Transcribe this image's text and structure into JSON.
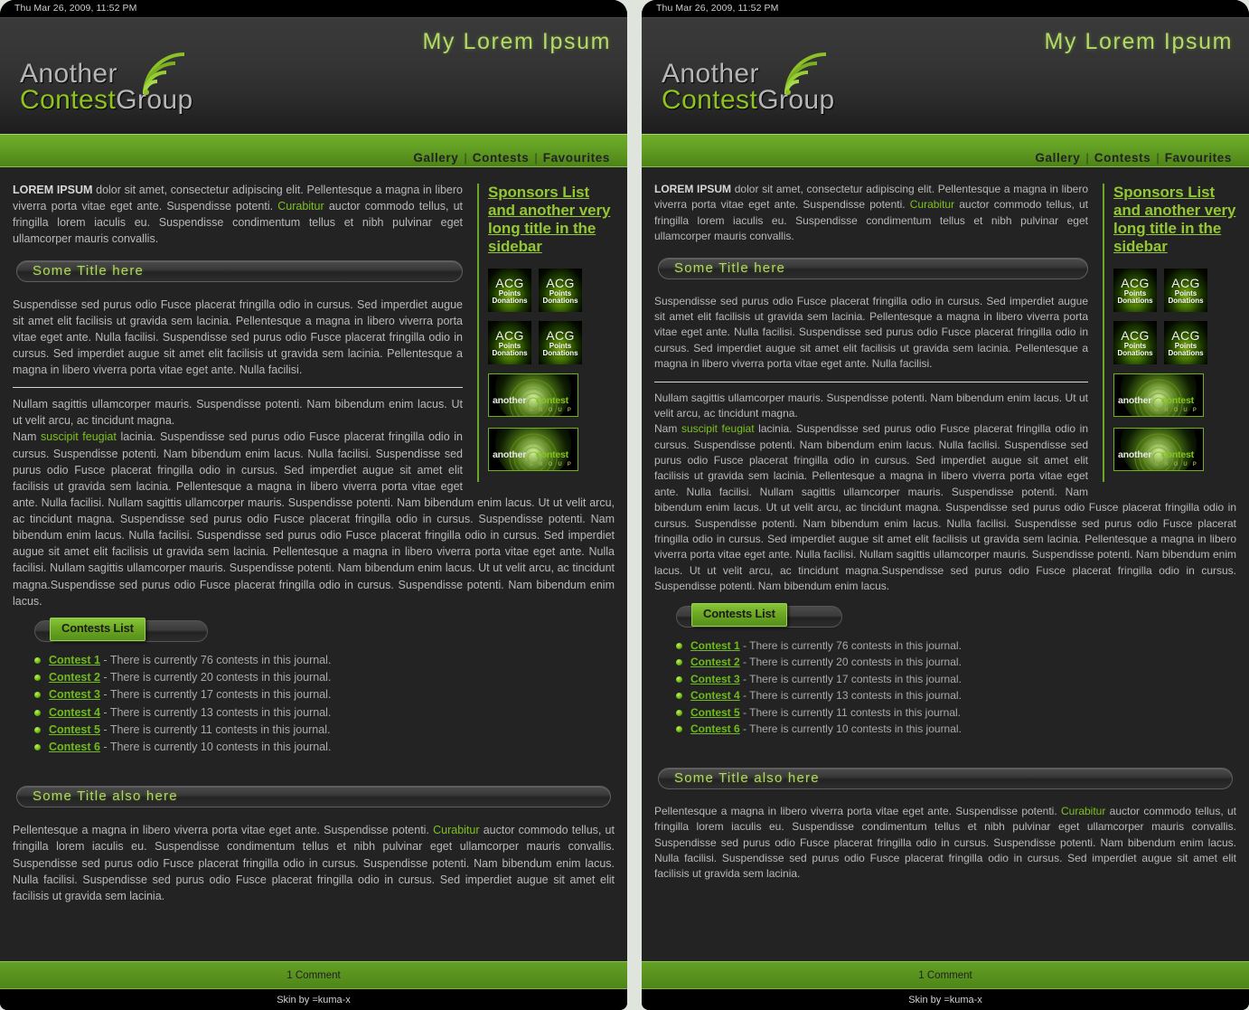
{
  "page": {
    "background_color": "#dfe5dc",
    "accent_green": "#63a024",
    "text_green": "#7cc11e"
  },
  "datebar": {
    "text": "Thu Mar 26, 2009, 11:52 PM"
  },
  "header": {
    "site_title": "My Lorem Ipsum",
    "logo": {
      "word1": "Another",
      "word2": "Contest",
      "word3": "Group",
      "icon": "wifi-arc-icon"
    }
  },
  "nav": {
    "items": [
      {
        "label": "Gallery"
      },
      {
        "label": "Contests"
      },
      {
        "label": "Favourites"
      }
    ],
    "separator": "|"
  },
  "main": {
    "lead_strong": "LOREM IPSUM",
    "lead_text_1": " dolor sit amet, consectetur adipiscing elit. Pellentesque a magna in libero viverra porta vitae eget ante. Suspendisse potenti. ",
    "lead_link": "Curabitur",
    "lead_text_2": " auctor commodo tellus, ut fringilla lorem iaculis eu. Suspendisse condimentum tellus et nibh pulvinar eget ullamcorper mauris convallis.",
    "section_title_1": "Some Title here",
    "para_1": "Suspendisse sed purus odio Fusce placerat fringilla odio in cursus. Sed imperdiet augue sit amet elit facilisis ut gravida sem lacinia. Pellentesque a magna in libero viverra porta vitae eget ante. Nulla facilisi. Suspendisse sed purus odio Fusce placerat fringilla odio in cursus. Sed imperdiet augue sit amet elit facilisis ut gravida sem lacinia. Pellentesque a magna in libero viverra porta vitae eget ante. Nulla facilisi.",
    "para_2": "Nullam sagittis ullamcorper mauris. Suspendisse potenti. Nam bibendum enim lacus. Ut ut velit arcu, ac tincidunt magna.",
    "para_3_pre": "Nam ",
    "para_3_link": "suscipit feugiat",
    "para_3_post": " lacinia. Suspendisse sed purus odio Fusce placerat fringilla odio in cursus. Suspendisse potenti. Nam bibendum enim lacus. Nulla facilisi. Suspendisse sed purus odio Fusce placerat fringilla odio in cursus. Sed imperdiet augue sit amet elit facilisis ut gravida sem lacinia. Pellentesque a magna in libero viverra porta vitae eget ante. Nulla facilisi. Nullam sagittis ullamcorper mauris. Suspendisse potenti. Nam bibendum enim lacus. Ut ut velit arcu, ac tincidunt magna. Suspendisse sed purus odio Fusce placerat fringilla odio in cursus. Suspendisse potenti. Nam bibendum enim lacus. Nulla facilisi. Suspendisse sed purus odio Fusce placerat fringilla odio in cursus. Sed imperdiet augue sit amet elit facilisis ut gravida sem lacinia. Pellentesque a magna in libero viverra porta vitae eget ante. Nulla facilisi. Nullam sagittis ullamcorper mauris. Suspendisse potenti. Nam bibendum enim lacus. Ut ut velit arcu, ac tincidunt magna.Suspendisse sed purus odio Fusce placerat fringilla odio in cursus. Suspendisse potenti. Nam bibendum enim lacus.",
    "contests_tab_label": "Contests List",
    "contests": [
      {
        "name": "Contest 1",
        "desc": " - There is currently 76 contests in this journal."
      },
      {
        "name": "Contest 2",
        "desc": " - There is currently 20 contests in this journal."
      },
      {
        "name": "Contest 3",
        "desc": " - There is currently 17 contests in this journal."
      },
      {
        "name": "Contest 4",
        "desc": " - There is currently 13 contests in this journal."
      },
      {
        "name": "Contest 5",
        "desc": " - There is currently 11 contests in this journal."
      },
      {
        "name": "Contest 6",
        "desc": " - There is currently 10 contests in this journal."
      }
    ],
    "section_title_2": "Some Title also here",
    "para_4_pre": "Pellentesque a magna in libero viverra porta vitae eget ante. Suspendisse potenti. ",
    "para_4_link": "Curabitur",
    "para_4_post": " auctor commodo tellus, ut fringilla lorem iaculis eu. Suspendisse condimentum tellus et nibh pulvinar eget ullamcorper mauris convallis. Suspendisse sed purus odio Fusce placerat fringilla odio in cursus. Suspendisse potenti. Nam bibendum enim lacus. Nulla facilisi. Suspendisse sed purus odio Fusce placerat fringilla odio in cursus. Sed imperdiet augue sit amet elit facilisis ut gravida sem lacinia."
  },
  "sidebar": {
    "title": "Sponsors List and another very long title in the sidebar",
    "acg_badges": [
      {
        "main": "ACG",
        "sub1": "Points",
        "sub2": "Donations"
      },
      {
        "main": "ACG",
        "sub1": "Points",
        "sub2": "Donations"
      },
      {
        "main": "ACG",
        "sub1": "Points",
        "sub2": "Donations"
      },
      {
        "main": "ACG",
        "sub1": "Points",
        "sub2": "Donations"
      }
    ],
    "acg_banners": [
      {
        "word1": "another",
        "word2": "contest",
        "word3": "G R O U P"
      },
      {
        "word1": "another",
        "word2": "contest",
        "word3": "G R O U P"
      }
    ]
  },
  "footer": {
    "comments": "1 Comment",
    "credit": "Skin by =kuma-x"
  }
}
